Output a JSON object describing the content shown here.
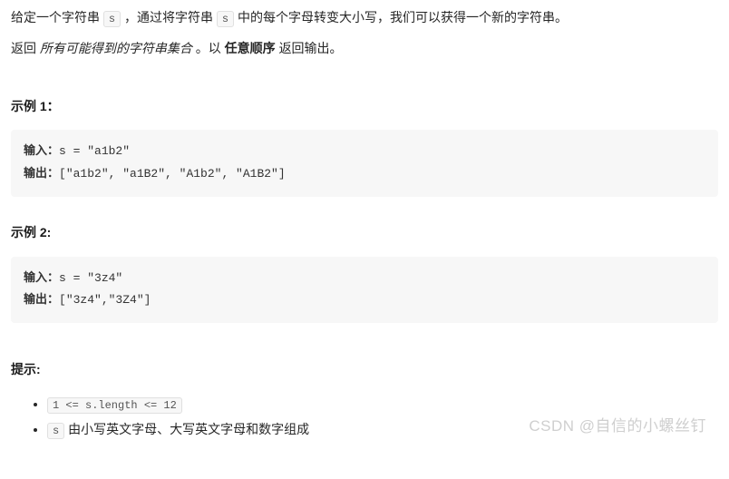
{
  "intro": {
    "p1_a": "给定一个字符串 ",
    "p1_code1": "s",
    "p1_b": " ，通过将字符串 ",
    "p1_code2": "s",
    "p1_c": " 中的每个字母转变大小写，我们可以获得一个新的字符串。",
    "p2_a": "返回 ",
    "p2_italic": "所有可能得到的字符串集合",
    "p2_b": " 。以 ",
    "p2_bold": "任意顺序",
    "p2_c": " 返回输出。"
  },
  "example1": {
    "heading": "示例 1：",
    "input_label": "输入：",
    "input_val": "s = \"a1b2\"",
    "output_label": "输出：",
    "output_val": "[\"a1b2\", \"a1B2\", \"A1b2\", \"A1B2\"]"
  },
  "example2": {
    "heading": "示例 2:",
    "input_label": "输入：",
    "input_val": "s = \"3z4\"",
    "output_label": "输出：",
    "output_val": "[\"3z4\",\"3Z4\"]"
  },
  "hints": {
    "heading": "提示:",
    "item1_code": "1 <= s.length <= 12",
    "item2_code": "s",
    "item2_text": " 由小写英文字母、大写英文字母和数字组成"
  },
  "watermark": "CSDN @自信的小螺丝钉"
}
